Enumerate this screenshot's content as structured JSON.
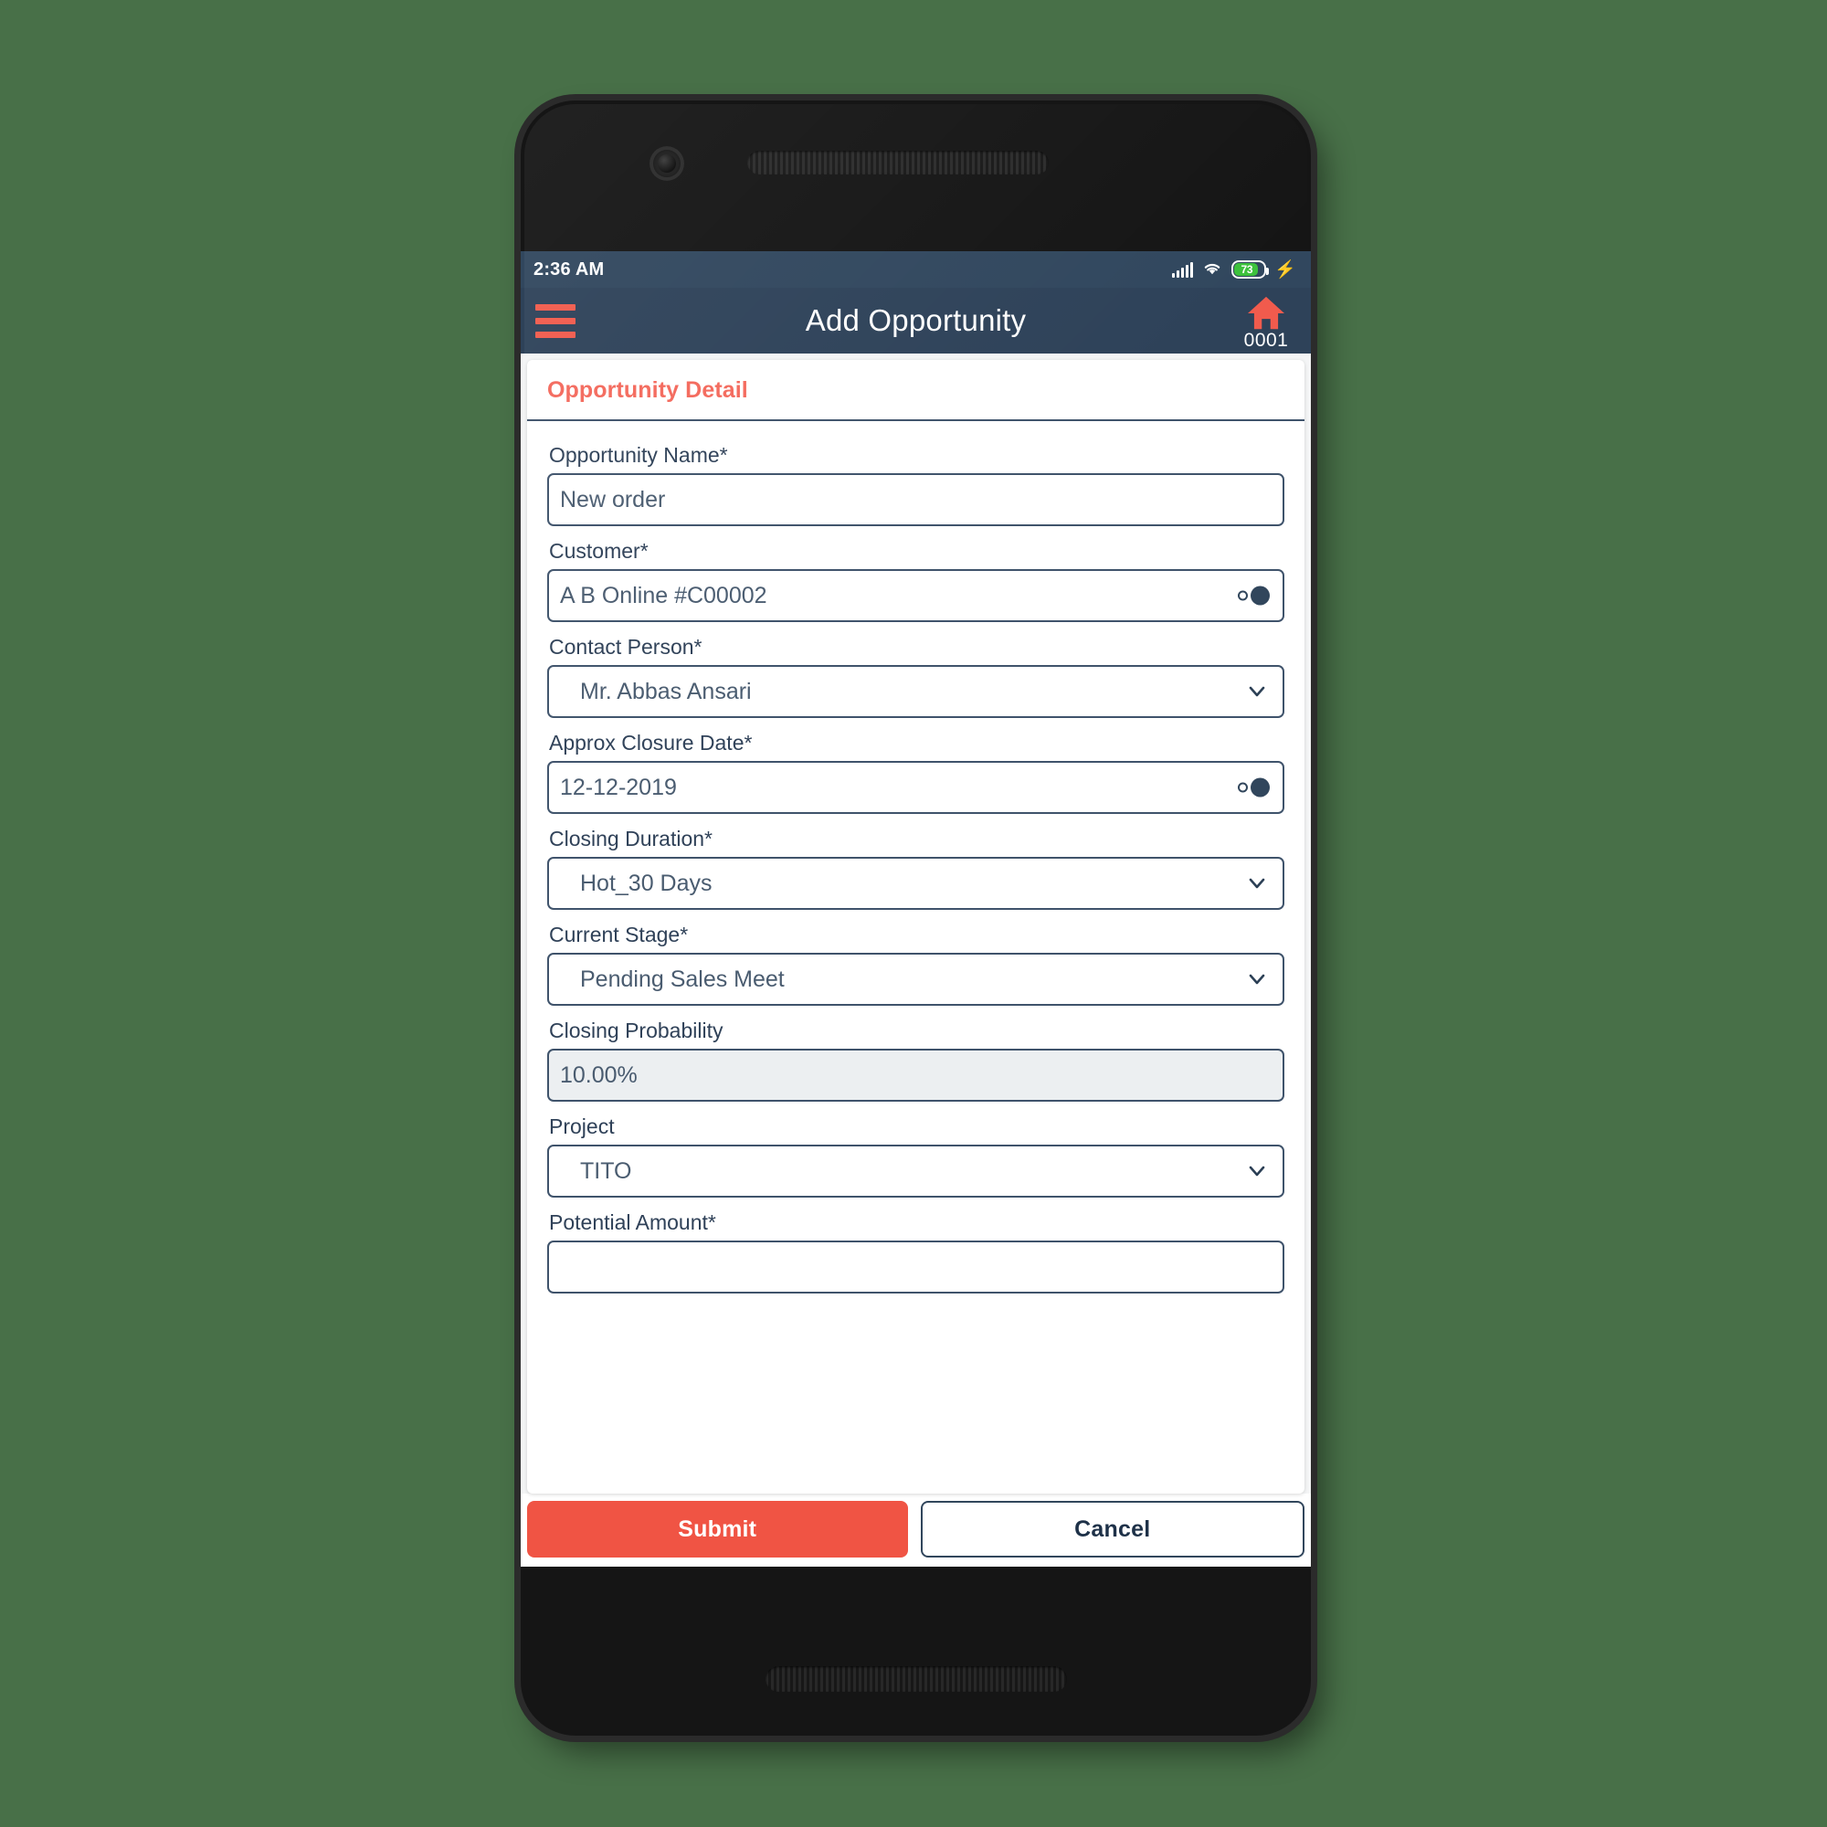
{
  "theme": {
    "page_background": "#487048",
    "appbar_color": "#2e4259",
    "statusbar_color": "#31475e",
    "accent_color": "#f15b4d",
    "field_border_color": "#3f536b",
    "readonly_field_background": "#eceff1"
  },
  "statusbar": {
    "time": "2:36 AM",
    "signal_icon": "signal-bars-icon",
    "wifi_icon": "wifi-icon",
    "battery_level": "73",
    "battery_icon": "battery-icon",
    "charging_icon": "charging-bolt-icon"
  },
  "appbar": {
    "menu_icon": "hamburger-menu-icon",
    "title": "Add Opportunity",
    "home_icon": "home-icon",
    "home_code": "0001"
  },
  "card": {
    "header_title": "Opportunity Detail"
  },
  "form": {
    "fields": [
      {
        "label": "Opportunity Name*",
        "name": "opportunity-name",
        "type": "text",
        "value": "New order",
        "placeholder": "",
        "trailing_icon": ""
      },
      {
        "label": "Customer*",
        "name": "customer",
        "type": "picker",
        "value": "A B Online #C00002",
        "placeholder": "",
        "trailing_icon": "search-picker-icon"
      },
      {
        "label": "Contact Person*",
        "name": "contact-person",
        "type": "select",
        "value": "Mr. Abbas Ansari",
        "placeholder": "",
        "trailing_icon": "chevron-down-icon"
      },
      {
        "label": "Approx Closure Date*",
        "name": "approx-closure-date",
        "type": "picker",
        "value": "12-12-2019",
        "placeholder": "",
        "trailing_icon": "calendar-picker-icon"
      },
      {
        "label": "Closing Duration*",
        "name": "closing-duration",
        "type": "select",
        "value": "Hot_30 Days",
        "placeholder": "",
        "trailing_icon": "chevron-down-icon"
      },
      {
        "label": "Current Stage*",
        "name": "current-stage",
        "type": "select",
        "value": "Pending Sales Meet",
        "placeholder": "",
        "trailing_icon": "chevron-down-icon"
      },
      {
        "label": "Closing Probability",
        "name": "closing-probability",
        "type": "readonly",
        "value": "10.00%",
        "placeholder": "",
        "trailing_icon": ""
      },
      {
        "label": "Project",
        "name": "project",
        "type": "select",
        "value": "TITO",
        "placeholder": "",
        "trailing_icon": "chevron-down-icon"
      },
      {
        "label": "Potential Amount*",
        "name": "potential-amount",
        "type": "text",
        "value": "",
        "placeholder": "",
        "trailing_icon": ""
      }
    ]
  },
  "footer": {
    "submit_label": "Submit",
    "cancel_label": "Cancel"
  }
}
